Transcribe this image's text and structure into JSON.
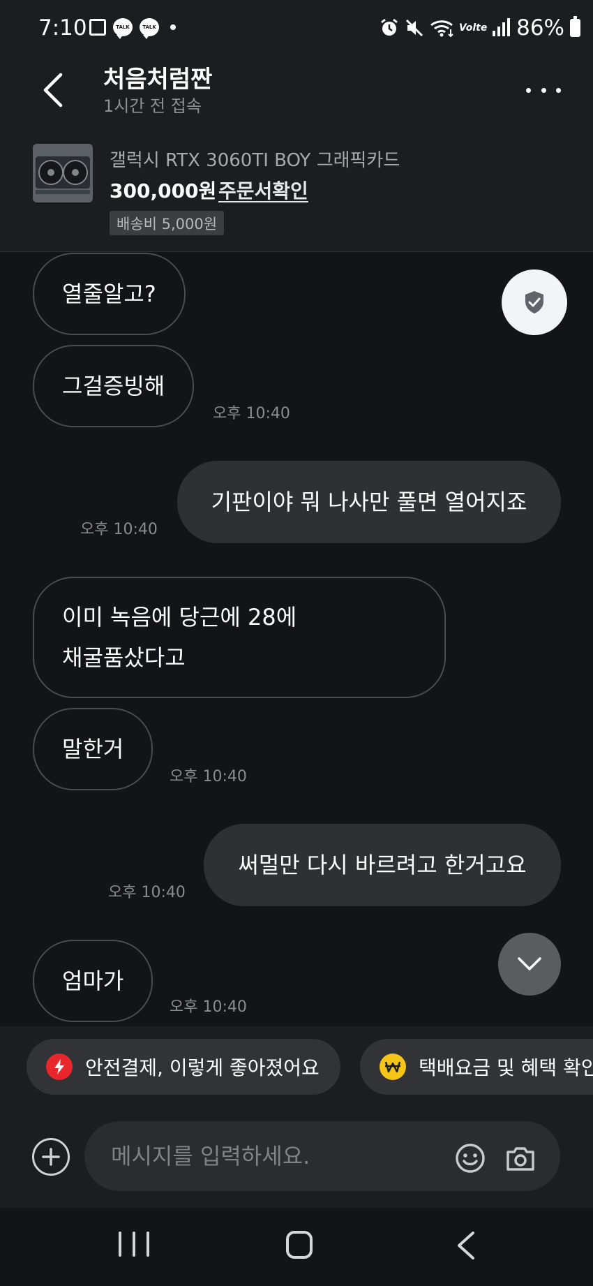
{
  "status_bar": {
    "time": "7:10",
    "left_icons": [
      "image-icon",
      "kakaotalk-icon",
      "kakaotalk-icon",
      "dot-icon"
    ],
    "talk_label": "TALK",
    "right_icons": [
      "alarm-icon",
      "mute-icon",
      "wifi-icon",
      "volte-icon",
      "signal-icon"
    ],
    "volte_label": "Volte",
    "battery": "86%"
  },
  "header": {
    "title": "처음처럼짠",
    "subtitle": "1시간 전 접속",
    "back_icon": "chevron-left-icon",
    "more_icon": "more-dots-icon"
  },
  "product": {
    "name": "갤럭시 RTX 3060TI BOY 그래픽카드",
    "price": "300,000원",
    "order_link": "주문서확인",
    "shipping": "배송비 5,000원"
  },
  "messages": [
    {
      "side": "in",
      "text": "열줄알고?",
      "time": ""
    },
    {
      "side": "in",
      "text": "그걸증빙해",
      "time": "오후 10:40"
    },
    {
      "side": "out",
      "text": "기판이야 뭐 나사만 풀면 열어지죠",
      "time": "오후 10:40"
    },
    {
      "side": "in",
      "text_lines": [
        "이미 녹음에 당근에 28에",
        "채굴품샀다고"
      ],
      "time": ""
    },
    {
      "side": "in",
      "text": "말한거",
      "time": "오후 10:40"
    },
    {
      "side": "out",
      "text": "써멀만 다시 바르려고 한거고요",
      "time": "오후 10:40"
    },
    {
      "side": "in",
      "text": "엄마가",
      "time": "오후 10:40"
    }
  ],
  "floating": {
    "shield_icon": "shield-check-icon",
    "scroll_icon": "chevron-down-icon"
  },
  "chips": [
    {
      "label": "안전결제, 이렇게 좋아졌어요",
      "icon": "lightning-icon",
      "color": "#e8262b"
    },
    {
      "label": "택배요금 및 혜택 확인",
      "icon": "won-coin-icon",
      "color": "#f5c518"
    }
  ],
  "input": {
    "placeholder": "메시지를 입력하세요.",
    "add_icon": "plus-icon",
    "emoji_icon": "smiley-icon",
    "camera_icon": "camera-icon"
  },
  "nav": {
    "recent_icon": "recent-apps-icon",
    "home_icon": "home-icon",
    "back_icon": "back-icon"
  }
}
